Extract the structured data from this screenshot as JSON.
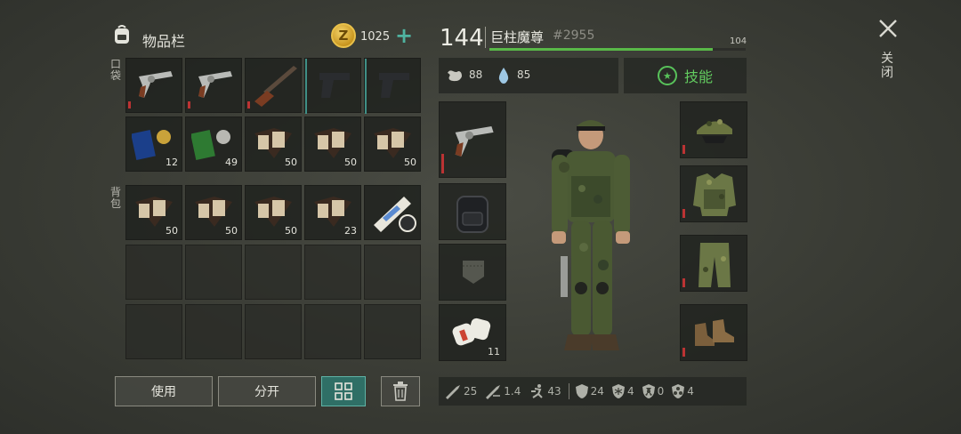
{
  "inventory": {
    "title": "物品栏",
    "coins": "1025",
    "add_symbol": "+",
    "pocket_label": "口袋",
    "backpack_label": "背包",
    "coin_letter": "Z"
  },
  "pocket_slots": [
    {
      "item": "revolver",
      "qty": ""
    },
    {
      "item": "revolver",
      "qty": ""
    },
    {
      "item": "shotgun",
      "qty": ""
    },
    {
      "item": "pistol",
      "qty": ""
    },
    {
      "item": "pistol",
      "qty": ""
    },
    {
      "item": "badge-book-blue",
      "qty": "12"
    },
    {
      "item": "badge-book-green",
      "qty": "49"
    },
    {
      "item": "ledger-book",
      "qty": "50"
    },
    {
      "item": "ledger-book",
      "qty": "50"
    },
    {
      "item": "ledger-book",
      "qty": "50"
    }
  ],
  "backpack_slots": [
    {
      "item": "ledger-book",
      "qty": "50"
    },
    {
      "item": "ledger-book",
      "qty": "50"
    },
    {
      "item": "ledger-book",
      "qty": "50"
    },
    {
      "item": "ledger-book",
      "qty": "23"
    },
    {
      "item": "blueprint-roll",
      "qty": ""
    }
  ],
  "buttons": {
    "use": "使用",
    "split": "分开"
  },
  "character": {
    "level": "144",
    "name": "巨柱魔尊",
    "id": "#2955",
    "xp_label": "104",
    "xp_fraction": 0.87,
    "hunger": "88",
    "thirst": "85",
    "skills": "技能"
  },
  "equipment": {
    "weapon": "revolver",
    "backpack": "backpack",
    "pocket": "pocket",
    "medkit_qty": "11",
    "head": "camo-cap-goggles",
    "body": "camo-armor-vest",
    "legs": "camo-pants",
    "feet": "boots"
  },
  "stats": [
    {
      "icon": "knife-icon",
      "value": "25"
    },
    {
      "icon": "attack-speed-icon",
      "value": "1.4"
    },
    {
      "icon": "sprint-icon",
      "value": "43"
    },
    {
      "icon": "armor-icon",
      "value": "24"
    },
    {
      "icon": "cold-resist-icon",
      "value": "4"
    },
    {
      "icon": "radiation-resist-icon",
      "value": "0"
    },
    {
      "icon": "bio-resist-icon",
      "value": "4"
    }
  ],
  "close": {
    "symbol": "×",
    "label": "关闭"
  },
  "colors": {
    "accent_teal": "#4fb3a0",
    "xp_green": "#59b948",
    "skill_green": "#62cb5f",
    "durability_red": "#b33"
  }
}
